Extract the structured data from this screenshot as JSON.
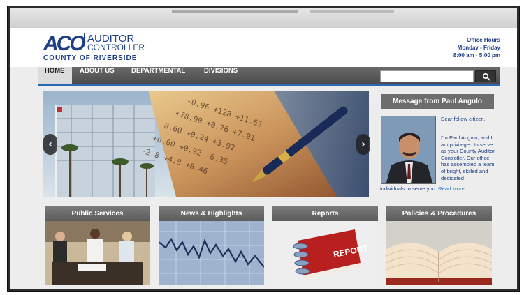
{
  "logo": {
    "mark": "ACO",
    "line1": "AUDITOR",
    "line2": "CONTROLLER",
    "county": "COUNTY OF RIVERSIDE"
  },
  "office_hours": {
    "title": "Office Hours",
    "days": "Monday - Friday",
    "time": "8:00 am - 5:00 pm"
  },
  "nav": {
    "items": [
      {
        "label": "HOME"
      },
      {
        "label": "ABOUT US"
      },
      {
        "label": "DEPARTMENTAL"
      },
      {
        "label": "DIVISIONS"
      }
    ],
    "search_placeholder": ""
  },
  "message": {
    "heading": "Message from Paul Angulo",
    "greeting": "Dear fellow citizen,",
    "body": "I'm Paul Angulo, and I am privileged to serve as your County Auditor-Controller. Our office has assembled a team of bright, skilled and dedicated",
    "tail": "individuals to serve you.",
    "read_more": "Read More..."
  },
  "cards": [
    {
      "title": "Public Services"
    },
    {
      "title": "News & Highlights"
    },
    {
      "title": "Reports",
      "image_text": "REPORT"
    },
    {
      "title": "Policies & Procedures"
    }
  ],
  "colors": {
    "brand_blue": "#1e3f86",
    "nav_accent": "#2a67b3",
    "link": "#3a78c9"
  }
}
